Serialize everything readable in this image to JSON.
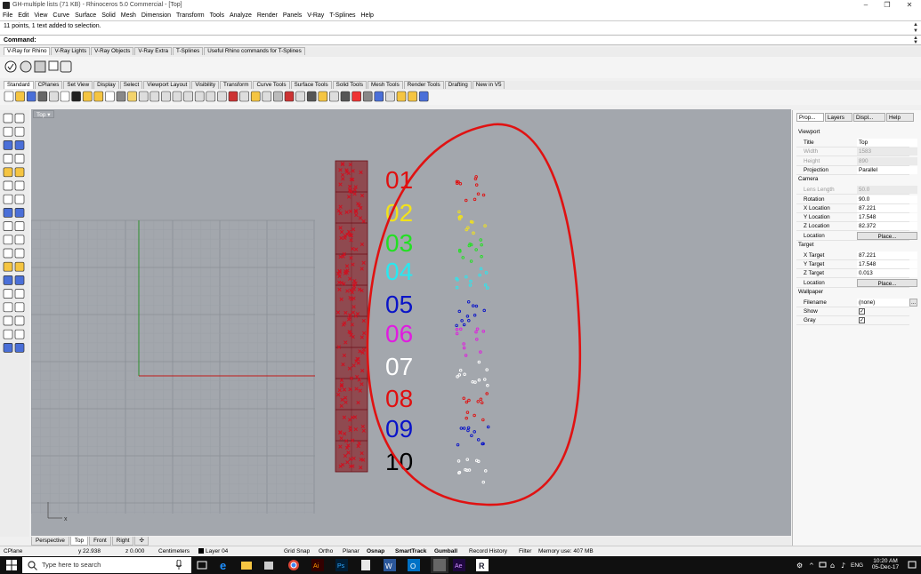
{
  "window": {
    "title": "GH-multiple lists (71 KB) - Rhinoceros 5.0 Commercial - [Top]",
    "controls": [
      "minimize-icon",
      "restore-icon",
      "close-icon"
    ]
  },
  "menu": [
    "File",
    "Edit",
    "View",
    "Curve",
    "Surface",
    "Solid",
    "Mesh",
    "Dimension",
    "Transform",
    "Tools",
    "Analyze",
    "Render",
    "Panels",
    "V-Ray",
    "T-Splines",
    "Help"
  ],
  "command": {
    "history": "11 points, 1 text added to selection.",
    "label": "Command:"
  },
  "plugin_tabs": [
    "V-Ray for Rhino",
    "V-Ray Lights",
    "V-Ray Objects",
    "V-Ray Extra",
    "T-Splines",
    "Useful Rhino commands for T-Splines"
  ],
  "main_tabs": [
    "Standard",
    "CPlanes",
    "Set View",
    "Display",
    "Select",
    "Viewport Layout",
    "Visibility",
    "Transform",
    "Curve Tools",
    "Surface Tools",
    "Solid Tools",
    "Mesh Tools",
    "Render Tools",
    "Drafting",
    "New in V5"
  ],
  "viewport": {
    "name": "Top",
    "axis_label": "x",
    "labels": [
      {
        "text": "01",
        "color": "#e01010"
      },
      {
        "text": "02",
        "color": "#f2e21a"
      },
      {
        "text": "03",
        "color": "#22e022"
      },
      {
        "text": "04",
        "color": "#28e8f0"
      },
      {
        "text": "05",
        "color": "#0a14c8"
      },
      {
        "text": "06",
        "color": "#e01ce0"
      },
      {
        "text": "07",
        "color": "#ffffff"
      },
      {
        "text": "08",
        "color": "#e01010"
      },
      {
        "text": "09",
        "color": "#0a14c8"
      },
      {
        "text": "10",
        "color": "#000000"
      }
    ]
  },
  "viewport_tabs": [
    "Perspective",
    "Top",
    "Front",
    "Right"
  ],
  "status": {
    "cplane": "CPlane",
    "y": "y 22.938",
    "z": "z 0.000",
    "units": "Centimeters",
    "layer": "Layer 04",
    "toggles": [
      "Grid Snap",
      "Ortho",
      "Planar",
      "Osnap",
      "SmartTrack",
      "Gumball",
      "Record History",
      "Filter"
    ],
    "memory": "Memory use: 407 MB"
  },
  "panel": {
    "tabs": [
      "Prop...",
      "Layers",
      "Displ...",
      "Help"
    ],
    "viewport_section": "Viewport",
    "viewport_rows": [
      {
        "k": "Title",
        "v": "Top",
        "dis": false
      },
      {
        "k": "Width",
        "v": "1583",
        "dis": true
      },
      {
        "k": "Height",
        "v": "890",
        "dis": true
      },
      {
        "k": "Projection",
        "v": "Parallel",
        "dis": false
      }
    ],
    "camera_section": "Camera",
    "camera_rows": [
      {
        "k": "Lens Length",
        "v": "50.0",
        "dis": true
      },
      {
        "k": "Rotation",
        "v": "90.0",
        "dis": false
      },
      {
        "k": "X Location",
        "v": "87.221",
        "dis": false
      },
      {
        "k": "Y Location",
        "v": "17.548",
        "dis": false
      },
      {
        "k": "Z Location",
        "v": "82.372",
        "dis": false
      }
    ],
    "camera_location_label": "Location",
    "place_button": "Place...",
    "target_section": "Target",
    "target_rows": [
      {
        "k": "X Target",
        "v": "87.221",
        "dis": false
      },
      {
        "k": "Y Target",
        "v": "17.548",
        "dis": false
      },
      {
        "k": "Z Target",
        "v": "0.013",
        "dis": false
      }
    ],
    "target_location_label": "Location",
    "wallpaper_section": "Wallpaper",
    "filename_label": "Filename",
    "filename_value": "(none)",
    "filename_button": "...",
    "show_label": "Show",
    "gray_label": "Gray"
  },
  "taskbar": {
    "search_placeholder": "Type here to search",
    "time": "10:20 AM",
    "date": "05-Dec-17",
    "lang": "ENG"
  }
}
